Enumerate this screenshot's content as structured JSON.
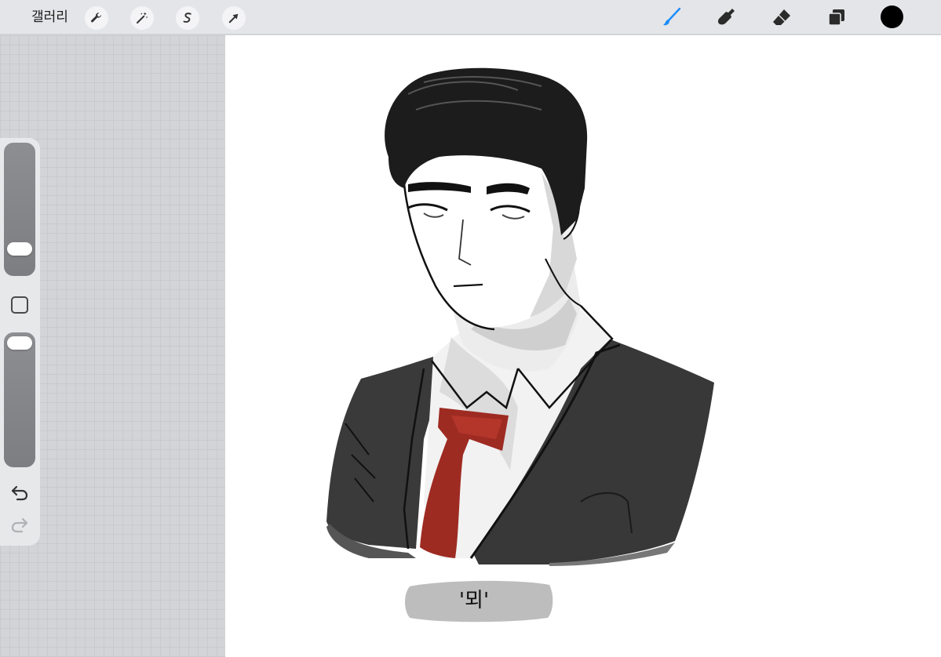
{
  "toolbar": {
    "gallery_label": "갤러리",
    "left_tools": [
      {
        "name": "actions",
        "icon": "wrench-icon"
      },
      {
        "name": "adjustments",
        "icon": "magic-wand-icon"
      },
      {
        "name": "selection",
        "icon": "selection-s-icon"
      },
      {
        "name": "transform",
        "icon": "arrow-cursor-icon"
      }
    ],
    "right_tools": [
      {
        "name": "brush",
        "icon": "brush-icon",
        "active": true
      },
      {
        "name": "smudge",
        "icon": "smudge-finger-icon"
      },
      {
        "name": "eraser",
        "icon": "eraser-icon"
      },
      {
        "name": "layers",
        "icon": "layers-icon"
      }
    ],
    "current_color": "#000000",
    "active_color": "#1a8cff"
  },
  "sidebar": {
    "brush_size_level": 0.23,
    "opacity_level": 0.92,
    "modify_icon": "square-icon",
    "undo_icon": "undo-arrow-icon",
    "redo_icon": "redo-arrow-icon"
  },
  "canvas": {
    "caption": "'뫼'",
    "tie_color": "#9e2b22"
  }
}
